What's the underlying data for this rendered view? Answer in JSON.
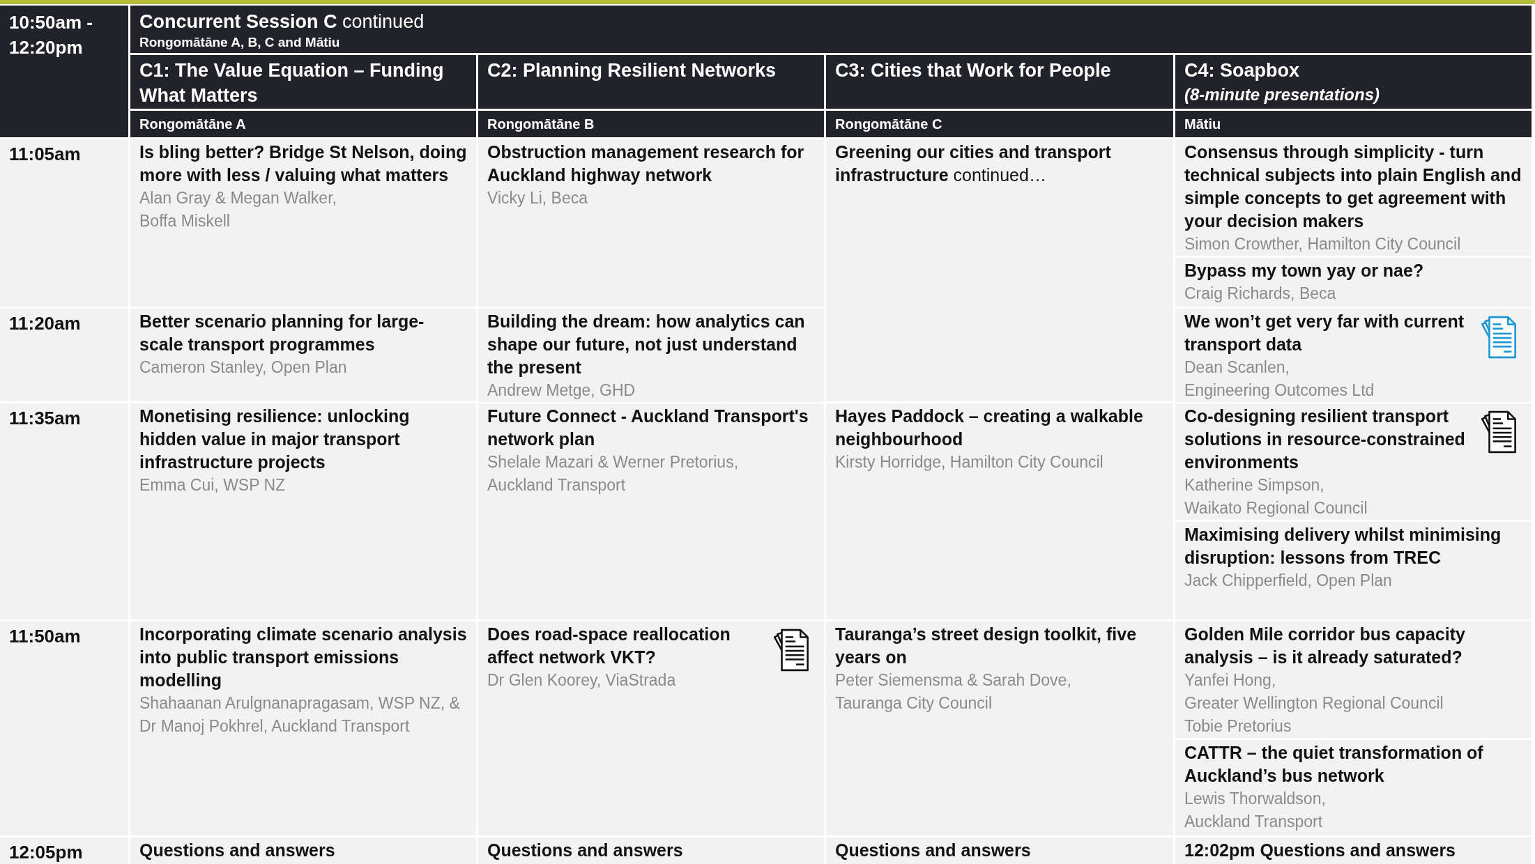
{
  "header": {
    "time": "10:50am - 12:20pm",
    "session": {
      "title": "Concurrent Session C",
      "note": "continued",
      "room": "Rongomātāne A, B, C and Mātiu"
    },
    "tracks": [
      {
        "title": "C1: The Value Equation – Funding What Matters",
        "room": "Rongomātāne A"
      },
      {
        "title": "C2: Planning Resilient Networks",
        "room": "Rongomātāne B"
      },
      {
        "title": "C3: Cities that Work for People",
        "room": "Rongomātāne C"
      },
      {
        "title": "C4: Soapbox",
        "subtitle": "(8-minute presentations)",
        "room": "Mātiu"
      }
    ]
  },
  "rows": [
    {
      "time": "11:05am",
      "cells": [
        {
          "talks": [
            {
              "title": "Is bling better? Bridge St Nelson, doing more with less / valuing what matters",
              "authors": [
                "Alan Gray & Megan Walker,",
                "Boffa Miskell"
              ]
            }
          ]
        },
        {
          "talks": [
            {
              "title": "Obstruction management research for Auckland highway network",
              "authors": [
                "Vicky Li, Beca"
              ]
            }
          ]
        },
        {
          "tall": true,
          "talks": [
            {
              "title": "Greening our cities and transport infrastructure",
              "note": "continued…"
            }
          ]
        },
        {
          "talks": [
            {
              "title": "Consensus through simplicity - turn technical subjects into plain English and simple concepts to get agreement with your decision makers",
              "authors": [
                "Simon Crowther, Hamilton City Council"
              ]
            },
            {
              "title": "Bypass my town yay or nae?",
              "authors": [
                "Craig Richards, Beca"
              ]
            }
          ]
        }
      ]
    },
    {
      "time": "11:20am",
      "cells": [
        {
          "talks": [
            {
              "title": "Better scenario planning for large-scale transport programmes",
              "authors": [
                "Cameron Stanley, Open Plan"
              ]
            }
          ]
        },
        {
          "talks": [
            {
              "title": "Building the dream: how analytics can shape our future, not just understand the present",
              "authors": [
                "Andrew Metge, GHD"
              ]
            }
          ]
        },
        {
          "talks": [
            {
              "title": "We won’t get very far with current transport data",
              "authors": [
                "Dean Scanlen,",
                "Engineering Outcomes Ltd"
              ],
              "kind": "documentblue"
            }
          ]
        }
      ]
    },
    {
      "time": "11:35am",
      "cells": [
        {
          "talks": [
            {
              "title": "Monetising resilience: unlocking hidden value in major transport infrastructure projects",
              "authors": [
                "Emma Cui, WSP NZ"
              ]
            }
          ]
        },
        {
          "talks": [
            {
              "title": "Future Connect - Auckland Transport's network plan",
              "authors": [
                "Shelale Mazari & Werner Pretorius,",
                "Auckland Transport"
              ]
            }
          ]
        },
        {
          "talks": [
            {
              "title": "Hayes Paddock – creating a walkable neighbourhood",
              "authors": [
                "Kirsty Horridge, Hamilton City Council"
              ]
            }
          ]
        },
        {
          "talks": [
            {
              "title": "Co-designing resilient transport solutions in resource-constrained environments",
              "authors": [
                "Katherine Simpson,",
                "Waikato Regional Council"
              ],
              "kind": "document"
            },
            {
              "title": "Maximising delivery whilst minimising disruption: lessons from TREC",
              "authors": [
                "Jack Chipperfield, Open Plan"
              ]
            }
          ]
        }
      ]
    },
    {
      "time": "11:50am",
      "cells": [
        {
          "talks": [
            {
              "title": "Incorporating climate scenario analysis into public transport emissions modelling",
              "authors": [
                "Shahaanan Arulgnanapragasam, WSP NZ, & Dr Manoj Pokhrel, Auckland Transport"
              ]
            }
          ]
        },
        {
          "talks": [
            {
              "title": "Does road-space reallocation affect network VKT?",
              "authors": [
                "Dr Glen Koorey, ViaStrada"
              ],
              "kind": "document"
            }
          ]
        },
        {
          "talks": [
            {
              "title": "Tauranga’s street design toolkit, five years on",
              "authors": [
                "Peter Siemensma & Sarah Dove,",
                "Tauranga City Council"
              ]
            }
          ]
        },
        {
          "talks": [
            {
              "title": "Golden Mile corridor bus capacity analysis – is it already saturated?",
              "authors": [
                "Yanfei Hong,",
                "Greater Wellington Regional Council",
                "Tobie Pretorius"
              ]
            },
            {
              "title": "CATTR – the quiet transformation of Auckland’s bus network",
              "authors": [
                "Lewis Thorwaldson,",
                "Auckland Transport"
              ]
            }
          ]
        }
      ]
    },
    {
      "time": "12:05pm",
      "cells": [
        {
          "talks": [
            {
              "title": "Questions and answers"
            }
          ]
        },
        {
          "talks": [
            {
              "title": "Questions and answers"
            }
          ]
        },
        {
          "talks": [
            {
              "title": "Questions and answers"
            }
          ]
        },
        {
          "talks": [
            {
              "title": "12:02pm Questions and answers"
            }
          ]
        }
      ]
    }
  ]
}
